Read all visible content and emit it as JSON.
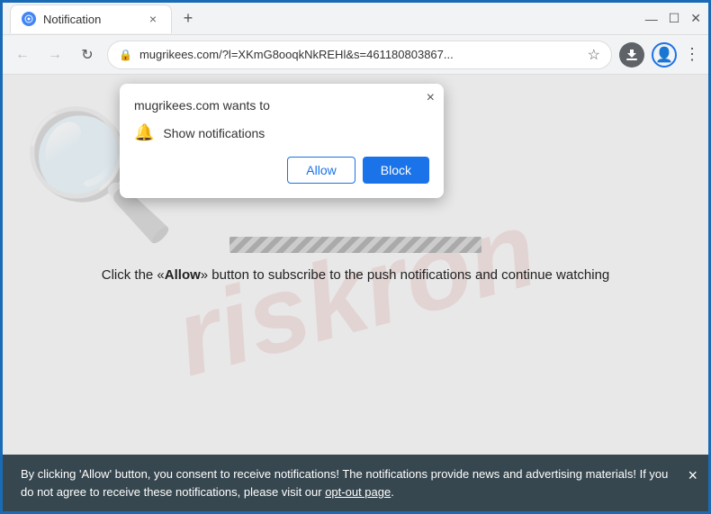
{
  "browser": {
    "tab": {
      "title": "Notification",
      "close_label": "×"
    },
    "new_tab_label": "+",
    "window_controls": {
      "minimize": "—",
      "maximize": "☐",
      "close": "✕"
    },
    "toolbar": {
      "back_label": "←",
      "forward_label": "→",
      "refresh_label": "↻",
      "url": "mugrikees.com/?l=XKmG8ooqkNkREHl&s=461180803867...",
      "star_label": "☆",
      "profile_label": "👤",
      "menu_label": "⋮"
    }
  },
  "notification_popup": {
    "close_label": "×",
    "title": "mugrikees.com wants to",
    "permission_text": "Show notifications",
    "allow_label": "Allow",
    "block_label": "Block"
  },
  "page": {
    "instruction": "Click the «Allow» button to subscribe to the push notifications and continue watching"
  },
  "banner": {
    "text_part1": "By clicking 'Allow' button, you consent to receive notifications! The notifications provide news and advertising materials! If you do not agree to receive these notifications, please visit our ",
    "link_text": "opt-out page",
    "text_part2": ".",
    "close_label": "×"
  },
  "watermark": {
    "text": "riskron"
  }
}
